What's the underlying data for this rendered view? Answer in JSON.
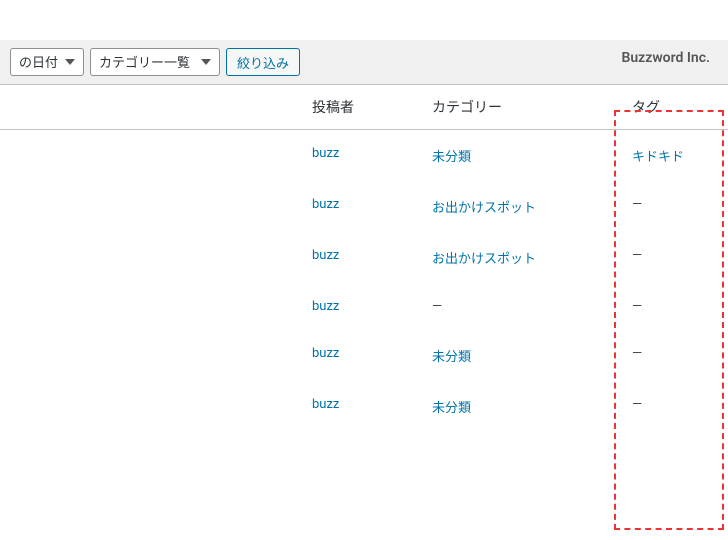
{
  "brand": "Buzzword Inc.",
  "filters": {
    "date_label": "の日付",
    "category_label": "カテゴリー一覧",
    "submit_label": "絞り込み"
  },
  "headers": {
    "author": "投稿者",
    "category": "カテゴリー",
    "tag": "タグ"
  },
  "rows": [
    {
      "author": "buzz",
      "category": "未分類",
      "tag": "キドキド",
      "tag_is_link": true
    },
    {
      "author": "buzz",
      "category": "お出かけスポット",
      "tag": "—",
      "tag_is_link": false
    },
    {
      "author": "buzz",
      "category": "お出かけスポット",
      "tag": "—",
      "tag_is_link": false
    },
    {
      "author": "buzz",
      "category": "—",
      "cat_is_link": false,
      "tag": "—",
      "tag_is_link": false
    },
    {
      "author": "buzz",
      "category": "未分類",
      "tag": "—",
      "tag_is_link": false
    },
    {
      "author": "buzz",
      "category": "未分類",
      "tag": "—",
      "tag_is_link": false
    }
  ]
}
